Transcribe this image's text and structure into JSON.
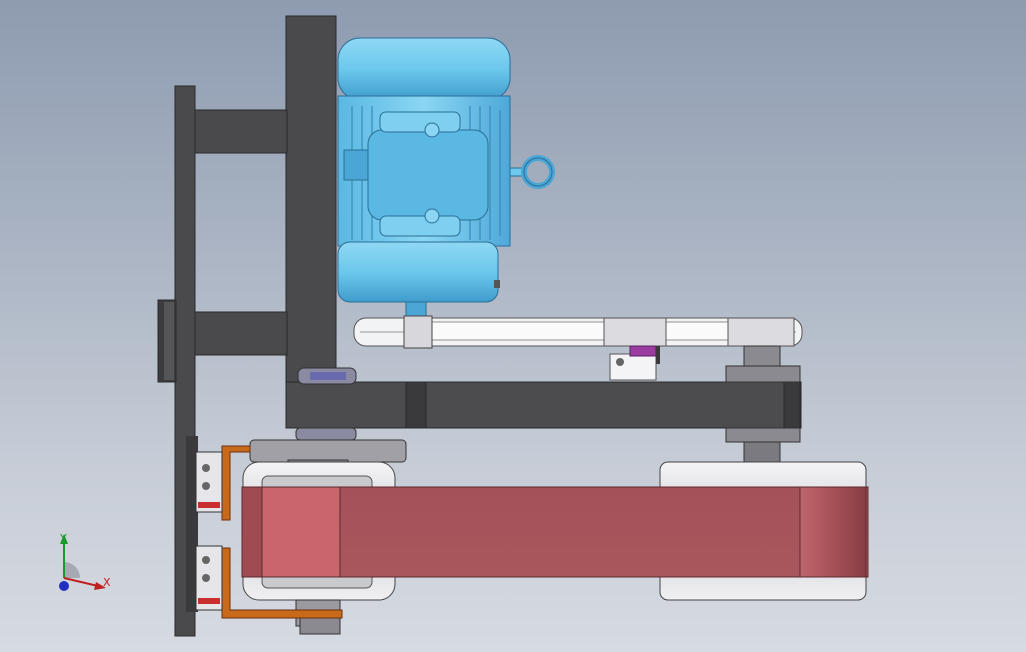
{
  "viewport": {
    "background_top": "#8e9bb0",
    "background_bottom": "#d6dae2"
  },
  "colors": {
    "frame": "#4a4a4c",
    "frame_dark": "#3a3a3c",
    "motor": "#6cc8ec",
    "motor_dark": "#4aa6d4",
    "belt_drive": "#e9ecef",
    "abrasive_belt": "#a8545a",
    "pulley": "#d8d8dc",
    "bracket": "#c86a1a"
  },
  "triad": {
    "y_label": "Y",
    "x_label": "X",
    "y_color": "#1a9a2a",
    "x_color": "#c02020",
    "z_color": "#2030c0"
  }
}
